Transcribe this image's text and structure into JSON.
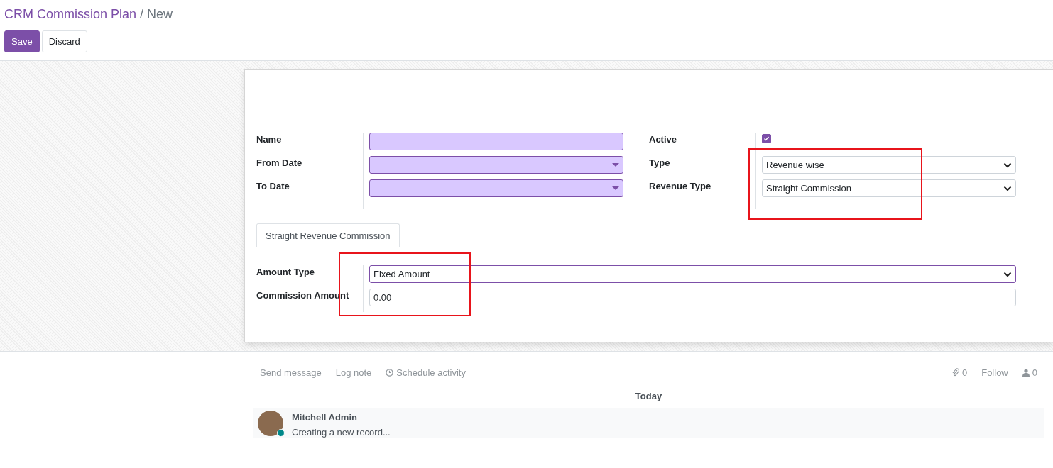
{
  "breadcrumb": {
    "parent": "CRM Commission Plan",
    "separator": "/",
    "current": "New"
  },
  "buttons": [
    {
      "label": "Save",
      "kind": "primary"
    },
    {
      "label": "Discard",
      "kind": "secondary"
    }
  ],
  "left_fields": [
    {
      "label": "Name",
      "kind": "text",
      "required": true
    },
    {
      "label": "From Date",
      "kind": "date",
      "required": true
    },
    {
      "label": "To Date",
      "kind": "date",
      "required": true
    }
  ],
  "right_fields": [
    {
      "label": "Active",
      "kind": "checkbox",
      "checked": true
    },
    {
      "label": "Type",
      "kind": "select",
      "value": "Revenue wise",
      "required": false
    },
    {
      "label": "Revenue Type",
      "kind": "select",
      "value": "Straight Commission",
      "required": false
    }
  ],
  "tabs": [
    {
      "label": "Straight Revenue Commission",
      "selected": true
    }
  ],
  "tab_fields": [
    {
      "label": "Amount Type",
      "kind": "select",
      "value": "Fixed Amount",
      "focused": true
    },
    {
      "label": "Commission Amount",
      "kind": "text",
      "value": "0.00",
      "focused": false
    }
  ],
  "chatter": {
    "actions": [
      {
        "label": "Send message",
        "kind": "plain"
      },
      {
        "label": "Log note",
        "kind": "plain"
      },
      {
        "label": "Schedule activity",
        "kind": "clock"
      }
    ],
    "topbar_right": [
      {
        "label": "0",
        "kind": "attachments"
      },
      {
        "label": "Follow",
        "kind": "plain"
      },
      {
        "label": "0",
        "kind": "followers"
      }
    ],
    "date_separator": "Today",
    "messages": [
      {
        "author": "Mitchell Admin",
        "body": "Creating a new record...",
        "online": true
      }
    ]
  }
}
